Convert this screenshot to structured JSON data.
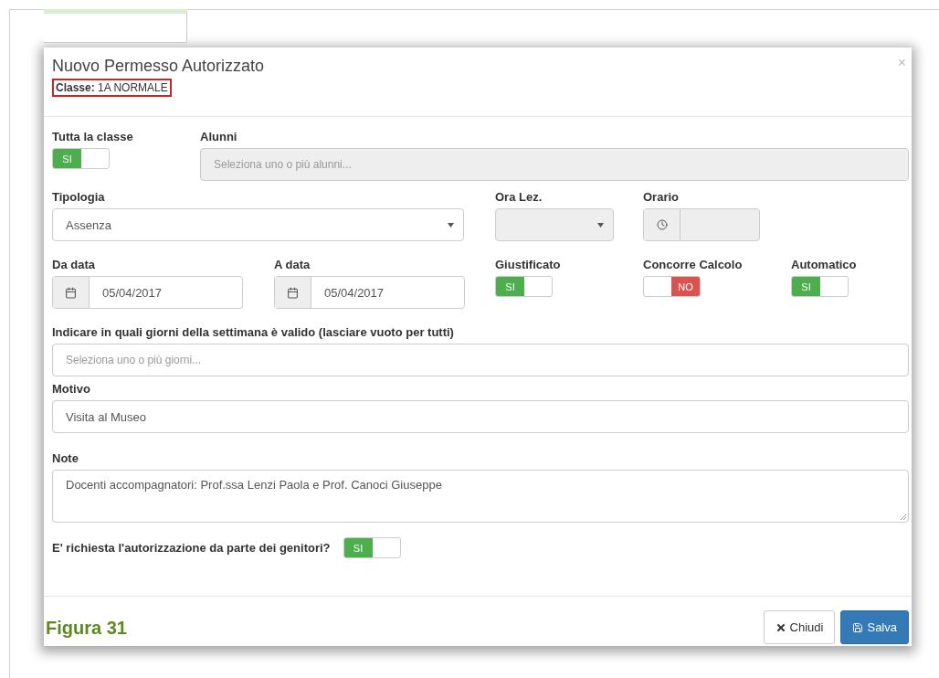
{
  "modal": {
    "title": "Nuovo Permesso Autorizzato",
    "subtitle": "**Classe:** 1A NORMALE",
    "subtitle_highlighted": true,
    "close": "×"
  },
  "tutta_la_classe": {
    "label": "Tutta la classe",
    "on": true,
    "text": "SI"
  },
  "alunni": {
    "label": "Alunni",
    "placeholder": "Seleziona uno o più alunni...",
    "disabled": true
  },
  "tipologia": {
    "label": "Tipologia",
    "value": "Assenza"
  },
  "ora_lez": {
    "label": "Ora Lez.",
    "disabled": true
  },
  "orario": {
    "label": "Orario",
    "disabled": true
  },
  "dates": [
    {
      "label": "Da data",
      "value": "05/04/2017"
    },
    {
      "label": "A data",
      "value": "05/04/2017"
    }
  ],
  "switches": [
    {
      "label": "Giustificato",
      "on": true,
      "text": "SI"
    },
    {
      "label": "Concorre Calcolo",
      "on": false,
      "text": "NO"
    },
    {
      "label": "Automatico",
      "on": true,
      "text": "SI"
    }
  ],
  "giorni": {
    "label": "Indicare in quali giorni della settimana è valido (lasciare vuoto per tutti)",
    "placeholder": "Seleziona uno o più giorni..."
  },
  "motivo": {
    "label": "Motivo",
    "value": "Visita al Museo"
  },
  "note": {
    "label": "Note",
    "value": "Docenti accompagnatori: Prof.ssa Lenzi Paola e Prof. Canoci Giuseppe"
  },
  "autorizzazione": {
    "label": "E' richiesta l'autorizzazione da parte dei genitori?",
    "on": true,
    "text": "SI"
  },
  "caption": "Figura 31",
  "buttons": [
    {
      "kind": "close",
      "label": "Chiudi"
    },
    {
      "kind": "save",
      "label": "Salva"
    }
  ]
}
